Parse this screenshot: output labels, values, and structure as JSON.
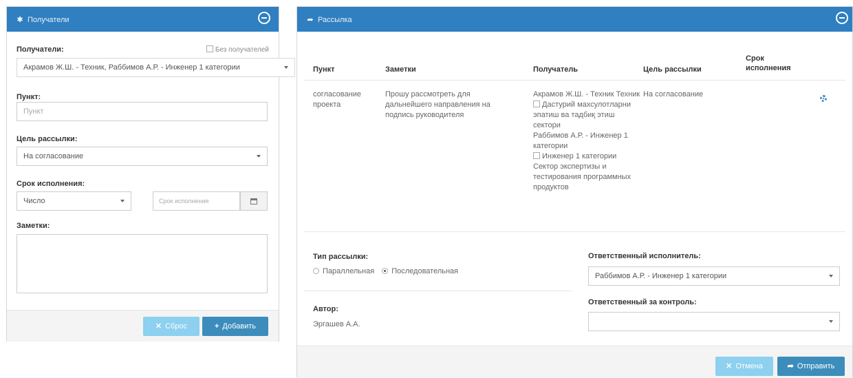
{
  "left_panel": {
    "title": "Получатели",
    "recipients_label": "Получатели:",
    "no_recipients_label": "Без получателей",
    "recipients_value": "Акрамов Ж.Ш. - Техник, Раббимов А.Р. - Инженер 1 категории",
    "point_label": "Пункт:",
    "point_placeholder": "Пункт",
    "purpose_label": "Цель рассылки:",
    "purpose_value": "На согласование",
    "deadline_label": "Срок исполнения:",
    "deadline_type_value": "Число",
    "deadline_placeholder": "Срок исполнения",
    "notes_label": "Заметки:",
    "reset_button": "Сброс",
    "add_button": "Добавить"
  },
  "right_panel": {
    "title": "Рассылка",
    "columns": [
      "Пункт",
      "Заметки",
      "Получатель",
      "Цель рассылки",
      "Срок исполнения"
    ],
    "row": {
      "point": "согласование проекта",
      "notes": "Прошу рассмотреть для дальнейшего направления на подпись руководителя",
      "recipient_1": "Акрамов Ж.Ш. - Техник Техник",
      "recipient_1_dept": "Дастурий махсулотларни эпатиш ва тадбиқ этиш сектори",
      "recipient_2": "Раббимов А.Р. - Инженер 1 категории",
      "recipient_2_dept": "Инженер 1 категории Сектор экспертизы и тестирования программных продуктов",
      "purpose": "На согласование",
      "deadline": ""
    },
    "dispatch_type_label": "Тип рассылки:",
    "dispatch_parallel": "Параллельная",
    "dispatch_sequential": "Последовательная",
    "author_label": "Автор:",
    "author_value": "Эргашев А.А.",
    "responsible_label": "Ответственный исполнитель:",
    "responsible_value": "Раббимов А.Р. - Инженер 1 категории",
    "control_label": "Ответственный за контроль:",
    "control_value": "",
    "cancel_button": "Отмена",
    "send_button": "Отправить"
  },
  "colors": {
    "header_blue": "#2f7fc1",
    "primary": "#3c8dbc",
    "info_light": "#8dd0ef"
  }
}
